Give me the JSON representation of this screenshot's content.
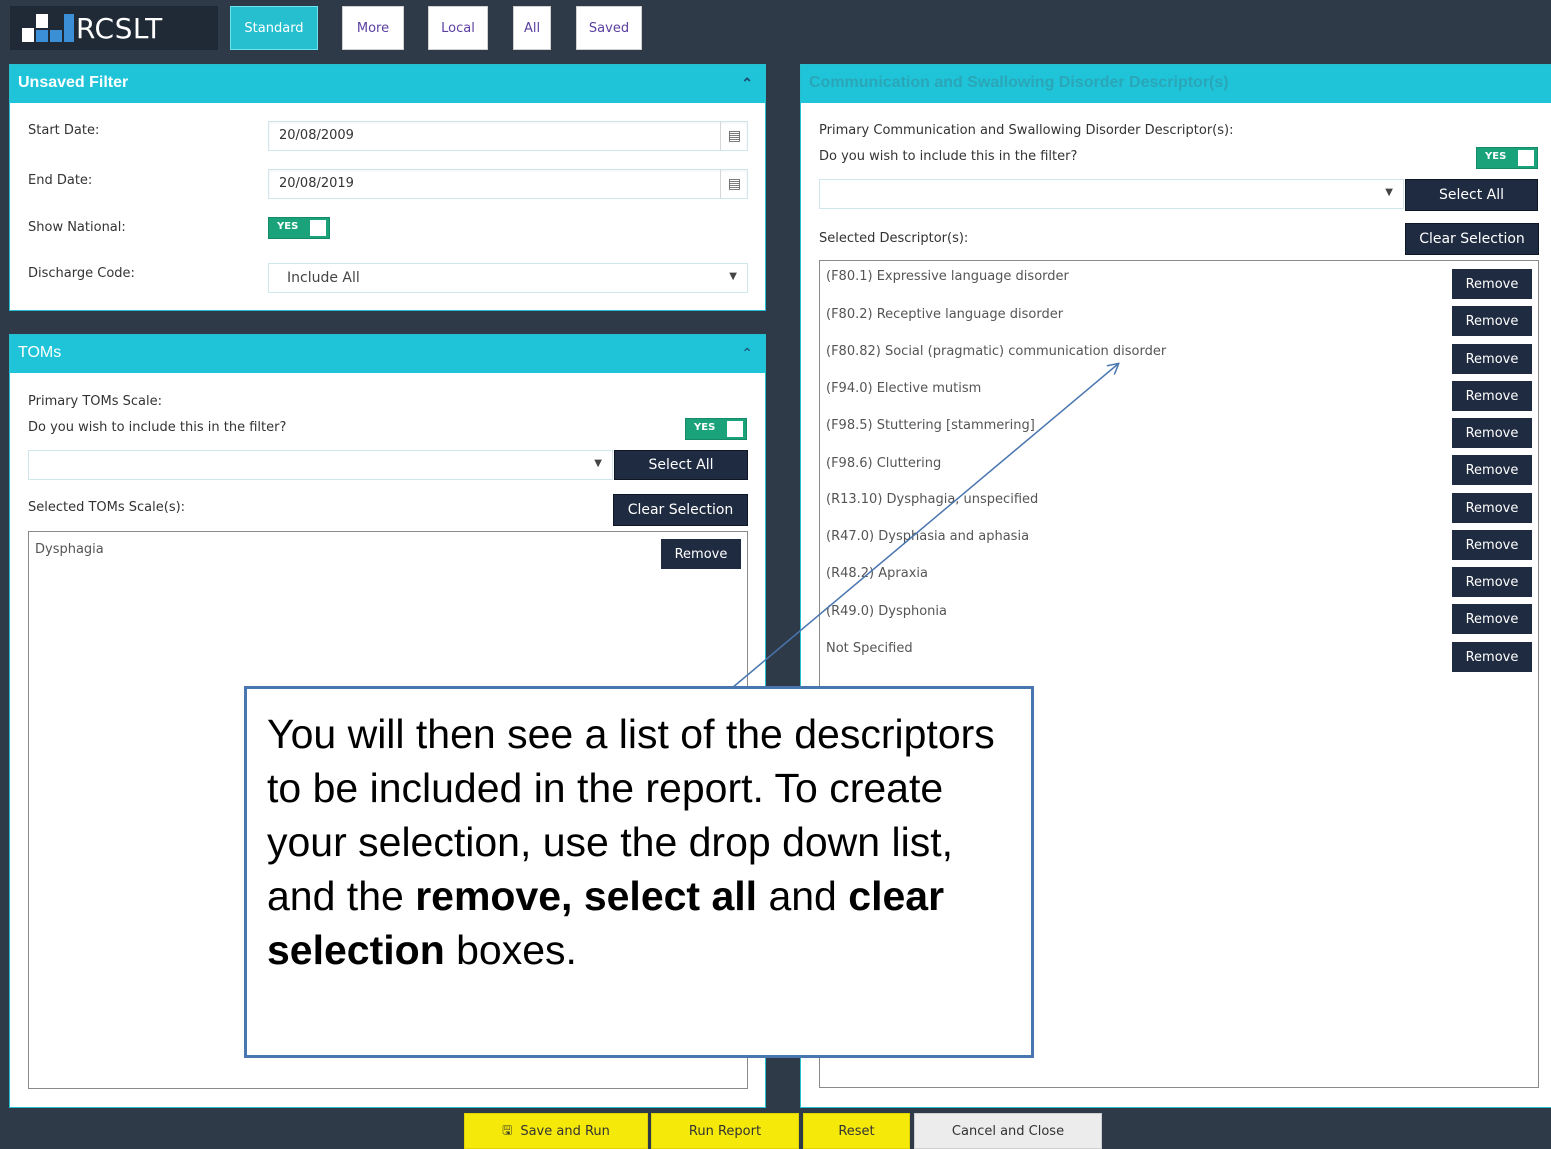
{
  "app": {
    "logo_text": "RCSLT"
  },
  "nav": {
    "tabs": [
      "Standard",
      "More",
      "Local",
      "All",
      "Saved"
    ],
    "active": "Standard"
  },
  "filter_panel": {
    "title": "Unsaved Filter",
    "start_date_label": "Start Date:",
    "start_date_value": "20/08/2009",
    "end_date_label": "End Date:",
    "end_date_value": "20/08/2019",
    "show_national_label": "Show National:",
    "show_national_toggle": "YES",
    "discharge_code_label": "Discharge Code:",
    "discharge_code_value": "Include All"
  },
  "toms_panel": {
    "title": "TOMs",
    "primary_label": "Primary TOMs Scale:",
    "include_question": "Do you wish to include this in the filter?",
    "include_toggle": "YES",
    "select_all_label": "Select All",
    "selected_label": "Selected TOMs Scale(s):",
    "clear_selection_label": "Clear Selection",
    "items": [
      "Dysphagia"
    ],
    "remove_label": "Remove"
  },
  "descriptor_panel": {
    "title": "Communication and Swallowing Disorder Descriptor(s)",
    "primary_label": "Primary Communication and Swallowing Disorder Descriptor(s):",
    "include_question": "Do you wish to include this in the filter?",
    "include_toggle": "YES",
    "select_all_label": "Select All",
    "selected_label": "Selected Descriptor(s):",
    "clear_selection_label": "Clear Selection",
    "remove_label": "Remove",
    "items": [
      "(F80.1) Expressive language disorder",
      "(F80.2) Receptive language disorder",
      "(F80.82) Social (pragmatic) communication disorder",
      "(F94.0) Elective mutism",
      "(F98.5) Stuttering [stammering]",
      "(F98.6) Cluttering",
      "(R13.10) Dysphagia, unspecified",
      "(R47.0) Dysphasia and aphasia",
      "(R48.2) Apraxia",
      "(R49.0) Dysphonia",
      "Not Specified"
    ]
  },
  "footer": {
    "save_run": "Save and Run",
    "run_report": "Run Report",
    "reset": "Reset",
    "cancel_close": "Cancel and Close"
  },
  "callout": {
    "part1": "You will then see a list of the descriptors to be included in the report. To create your selection, use the drop down list, and the ",
    "bold1": "remove, select all",
    "part2": " and ",
    "bold2": "clear selection",
    "part3": " boxes."
  },
  "colors": {
    "accent": "#1fc4d8",
    "dark_button": "#1f2b40",
    "toggle_green": "#1aa37a",
    "footer_yellow": "#f5e90a"
  },
  "icons": [
    "calendar-icon",
    "chevron-up-icon",
    "dropdown-arrow-icon",
    "save-icon"
  ]
}
